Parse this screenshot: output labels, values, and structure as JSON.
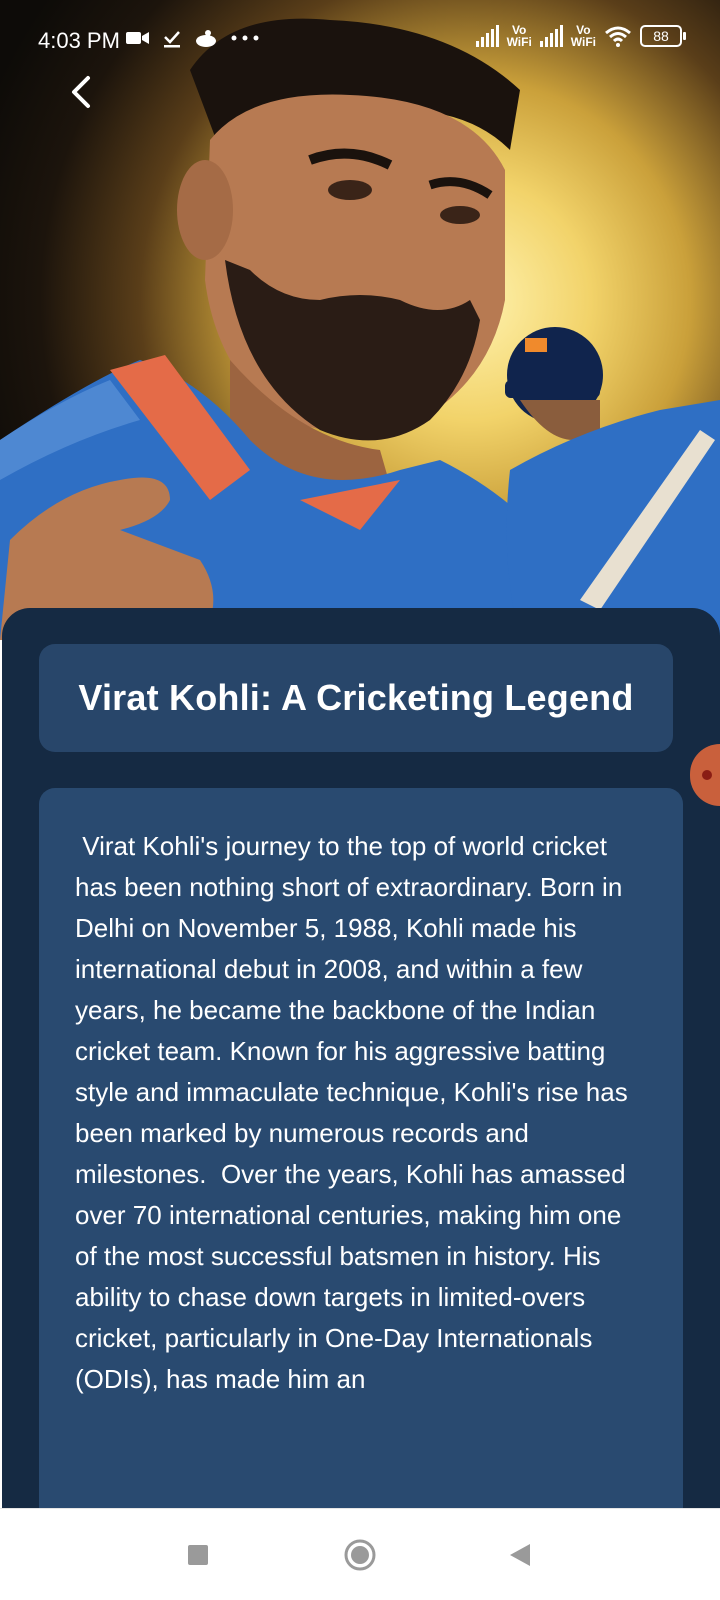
{
  "status_bar": {
    "time": "4:03 PM",
    "battery": "88",
    "network_1": "Vo WiFi",
    "network_2": "Vo WiFi",
    "icons": [
      "video-camera-icon",
      "download-icon",
      "cloud-icon",
      "more-dots-icon",
      "signal-icon",
      "wifi-icon",
      "battery-icon"
    ]
  },
  "header": {
    "back_icon": "chevron-left-icon"
  },
  "article": {
    "title": "Virat Kohli: A Cricketing Legend",
    "body": " Virat Kohli's journey to the top of world cricket has been nothing short of extraordinary. Born in Delhi on November 5, 1988, Kohli made his international debut in 2008, and within a few years, he became the backbone of the Indian cricket team. Known for his aggressive batting style and immaculate technique, Kohli's rise has been marked by numerous records and milestones.  Over the years, Kohli has amassed over 70 international centuries, making him one of the most successful batsmen in history. His ability to chase down targets in limited-overs cricket, particularly in One-Day Internationals (ODIs), has made him an"
  },
  "navigation": {
    "items": [
      "recent-apps-icon",
      "home-icon",
      "back-triangle-icon"
    ]
  },
  "colors": {
    "panel": "#152a43",
    "title_card": "#28466a",
    "body_card": "#294a70",
    "text": "#ffffff"
  }
}
